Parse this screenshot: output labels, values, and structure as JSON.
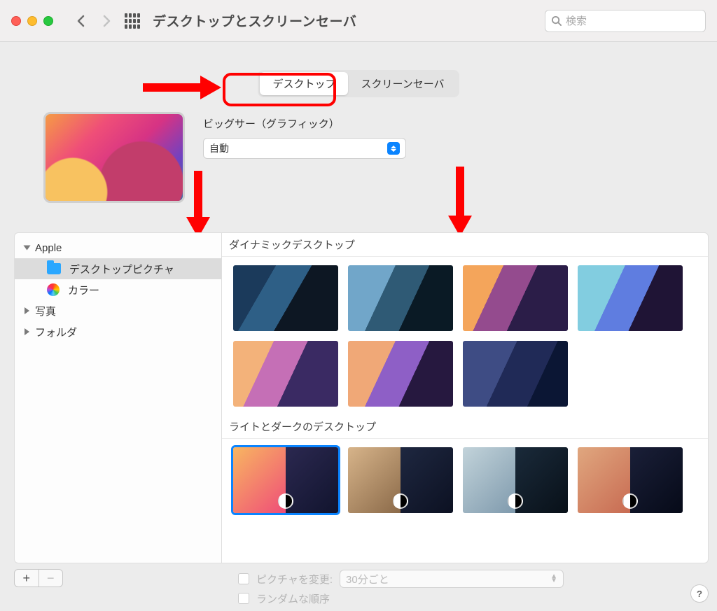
{
  "toolbar": {
    "title": "デスクトップとスクリーンセーバ",
    "search_placeholder": "検索"
  },
  "tabs": {
    "desktop": "デスクトップ",
    "screensaver": "スクリーンセーバ"
  },
  "preview": {
    "wallpaper_name": "ビッグサー（グラフィック）",
    "mode_selected": "自動"
  },
  "sidebar": {
    "apple": "Apple",
    "desktop_pictures": "デスクトップピクチャ",
    "colors": "カラー",
    "photos": "写真",
    "folders": "フォルダ"
  },
  "sections": {
    "dynamic": "ダイナミックデスクトップ",
    "light_dark": "ライトとダークのデスクトップ"
  },
  "footer": {
    "change_picture_label": "ピクチャを変更:",
    "interval_selected": "30分ごと",
    "random_label": "ランダムな順序",
    "plus": "+",
    "minus": "−",
    "help": "?"
  }
}
